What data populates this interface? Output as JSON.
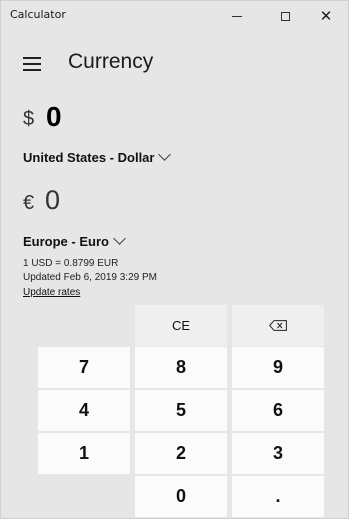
{
  "window": {
    "title": "Calculator",
    "minimize_icon": "minimize-icon",
    "maximize_icon": "maximize-icon",
    "close_icon": "close-icon",
    "close_glyph": "✕"
  },
  "header": {
    "menu_icon": "hamburger-menu-icon",
    "mode_title": "Currency"
  },
  "from": {
    "symbol": "$",
    "value": "0",
    "currency": "United States - Dollar"
  },
  "to": {
    "symbol": "€",
    "value": "0",
    "currency": "Europe - Euro"
  },
  "rate": {
    "conversion": "1 USD = 0.8799 EUR",
    "updated": "Updated Feb 6, 2019 3:29 PM",
    "update_link": "Update rates"
  },
  "keypad": {
    "ce": "CE",
    "backspace_icon": "backspace-icon",
    "k7": "7",
    "k8": "8",
    "k9": "9",
    "k4": "4",
    "k5": "5",
    "k6": "6",
    "k1": "1",
    "k2": "2",
    "k3": "3",
    "k0": "0",
    "decimal": "."
  },
  "colors": {
    "background": "#e6e6e6",
    "digit_key": "#fbfbfb",
    "function_key": "#efefef"
  }
}
